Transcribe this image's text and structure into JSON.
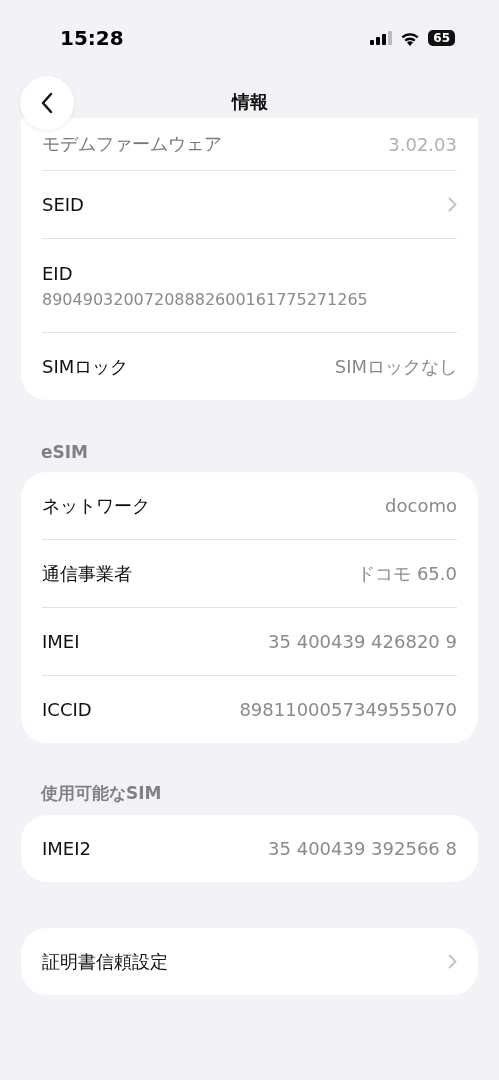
{
  "status_bar": {
    "time": "15:28",
    "battery": "65"
  },
  "nav": {
    "title": "情報"
  },
  "sections": [
    {
      "rows": [
        {
          "kind": "value",
          "label": "モデムファームウェア",
          "value": "3.02.03"
        },
        {
          "kind": "link",
          "label": "SEID"
        },
        {
          "kind": "stacked",
          "label": "EID",
          "value": "89049032007208882600161775271265"
        },
        {
          "kind": "value",
          "label": "SIMロック",
          "value": "SIMロックなし"
        }
      ]
    },
    {
      "header": "eSIM",
      "rows": [
        {
          "kind": "value",
          "label": "ネットワーク",
          "value": "docomo"
        },
        {
          "kind": "value",
          "label": "通信事業者",
          "value": "ドコモ 65.0"
        },
        {
          "kind": "value",
          "label": "IMEI",
          "value": "35 400439 426820 9"
        },
        {
          "kind": "value",
          "label": "ICCID",
          "value": "8981100057349555070"
        }
      ]
    },
    {
      "header": "使用可能なSIM",
      "rows": [
        {
          "kind": "value",
          "label": "IMEI2",
          "value": "35 400439 392566 8"
        }
      ]
    },
    {
      "rows": [
        {
          "kind": "link",
          "label": "証明書信頼設定"
        }
      ]
    }
  ]
}
